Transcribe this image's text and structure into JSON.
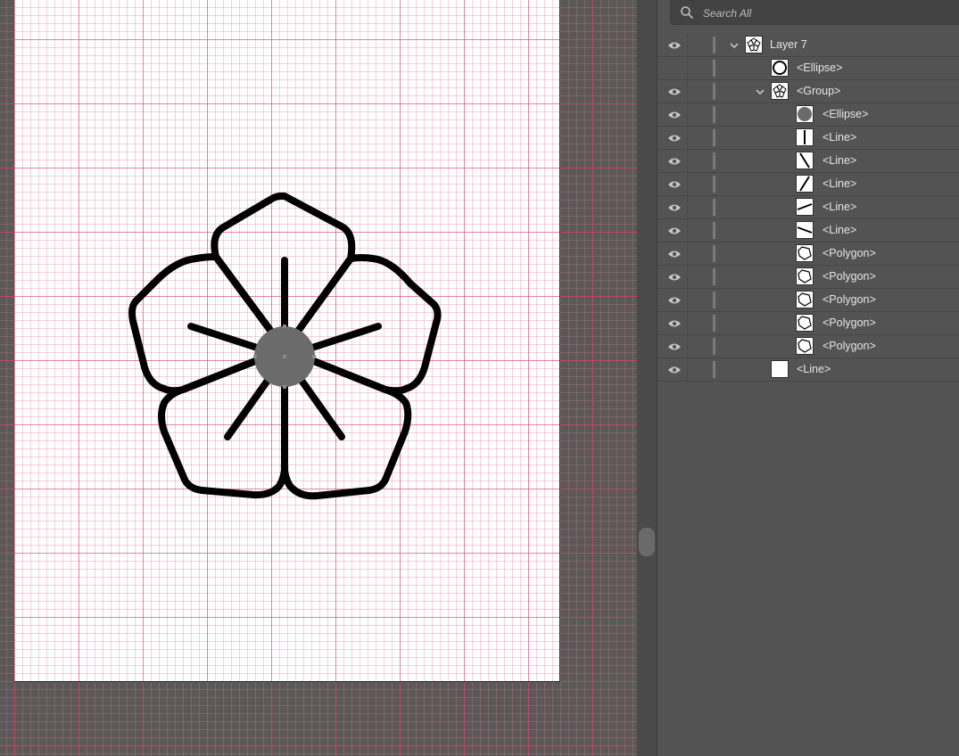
{
  "layers_panel": {
    "search": {
      "placeholder": "Search All"
    },
    "rows": [
      {
        "label": "Layer 7",
        "kind": "layer",
        "eye": true,
        "expanded": true,
        "thumb": "flower-icon"
      },
      {
        "label": "<Ellipse>",
        "kind": "item",
        "eye": false,
        "thumb": "ellipse-ring-icon"
      },
      {
        "label": "<Group>",
        "kind": "group",
        "eye": true,
        "expanded": true,
        "thumb": "flower-icon"
      },
      {
        "label": "<Ellipse>",
        "kind": "item",
        "eye": true,
        "thumb": "ellipse-filled-icon"
      },
      {
        "label": "<Line>",
        "kind": "item",
        "eye": true,
        "thumb": "line-vertical-icon"
      },
      {
        "label": "<Line>",
        "kind": "item",
        "eye": true,
        "thumb": "line-diag-down-icon"
      },
      {
        "label": "<Line>",
        "kind": "item",
        "eye": true,
        "thumb": "line-diag-up-icon"
      },
      {
        "label": "<Line>",
        "kind": "item",
        "eye": true,
        "thumb": "line-shallow-up-icon"
      },
      {
        "label": "<Line>",
        "kind": "item",
        "eye": true,
        "thumb": "line-shallow-down-icon"
      },
      {
        "label": "<Polygon>",
        "kind": "item",
        "eye": true,
        "thumb": "polygon-icon"
      },
      {
        "label": "<Polygon>",
        "kind": "item",
        "eye": true,
        "thumb": "polygon-icon"
      },
      {
        "label": "<Polygon>",
        "kind": "item",
        "eye": true,
        "thumb": "polygon-icon"
      },
      {
        "label": "<Polygon>",
        "kind": "item",
        "eye": true,
        "thumb": "polygon-icon"
      },
      {
        "label": "<Polygon>",
        "kind": "item",
        "eye": true,
        "thumb": "polygon-icon"
      },
      {
        "label": "<Line>",
        "kind": "item-root",
        "eye": true,
        "thumb": "blank-icon"
      }
    ]
  },
  "colors": {
    "panel_bg": "#535353",
    "artboard_bg": "#ffffff",
    "grid_major": "#d6466e",
    "grid_minor": "#e896b4",
    "stroke": "#000000",
    "center_fill": "#6b6b6b",
    "label_text": "#e6e6e6"
  }
}
